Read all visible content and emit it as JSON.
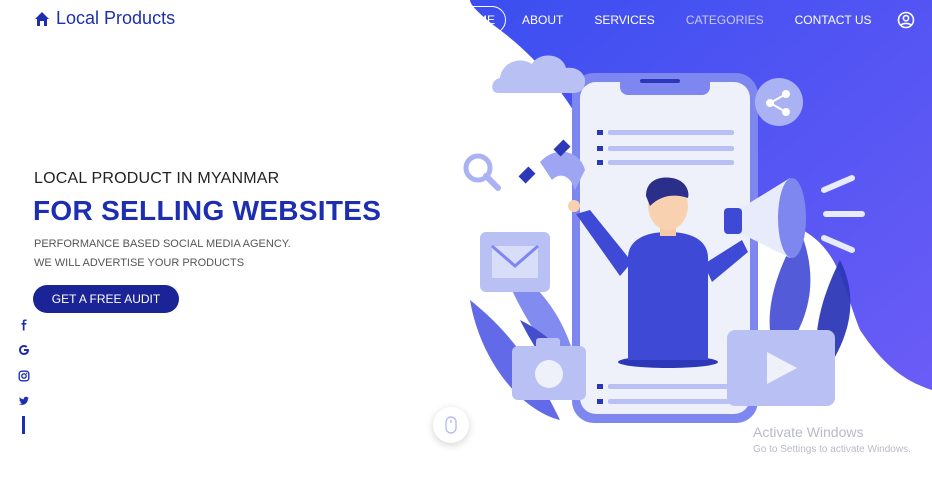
{
  "brand": {
    "name": "Local Products",
    "icon": "home-icon"
  },
  "nav": {
    "items": [
      {
        "label": "HOME",
        "active": true
      },
      {
        "label": "ABOUT",
        "active": false
      },
      {
        "label": "SERVICES",
        "active": false
      },
      {
        "label": "CATEGORIES",
        "active": false
      },
      {
        "label": "CONTACT US",
        "active": false
      }
    ],
    "user_icon": "user-circle-icon"
  },
  "hero": {
    "eyebrow": "LOCAL PRODUCT IN MYANMAR",
    "headline": "FOR SELLING WEBSITES",
    "lines": [
      "PERFORMANCE BASED SOCIAL MEDIA AGENCY.",
      "WE WILL ADVERTISE YOUR PRODUCTS"
    ],
    "cta_label": "GET A FREE AUDIT"
  },
  "social": [
    "facebook-icon",
    "google-icon",
    "instagram-icon",
    "twitter-icon"
  ],
  "colors": {
    "accent": "#1d2fb0",
    "gradient_start": "#3b4ef0",
    "gradient_end": "#6a5cf5",
    "button": "#1b2497"
  },
  "watermark": {
    "title": "Activate Windows",
    "subtitle": "Go to Settings to activate Windows."
  }
}
